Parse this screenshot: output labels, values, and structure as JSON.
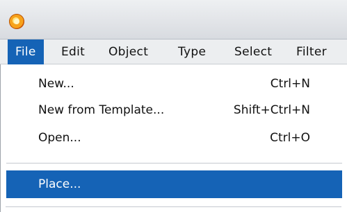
{
  "menubar": {
    "items": [
      {
        "label": "File",
        "active": true
      },
      {
        "label": "Edit"
      },
      {
        "label": "Object"
      },
      {
        "label": "Type"
      },
      {
        "label": "Select"
      },
      {
        "label": "Filter"
      }
    ]
  },
  "file_menu": {
    "items": [
      {
        "label": "New...",
        "shortcut": "Ctrl+N"
      },
      {
        "label": "New from Template...",
        "shortcut": "Shift+Ctrl+N"
      },
      {
        "label": "Open...",
        "shortcut": "Ctrl+O"
      },
      {
        "label": "Place...",
        "shortcut": "",
        "selected": true
      }
    ]
  },
  "colors": {
    "highlight": "#1563b6",
    "menubar_bg": "#eceef0"
  },
  "icons": {
    "app": "app-logo-icon"
  }
}
